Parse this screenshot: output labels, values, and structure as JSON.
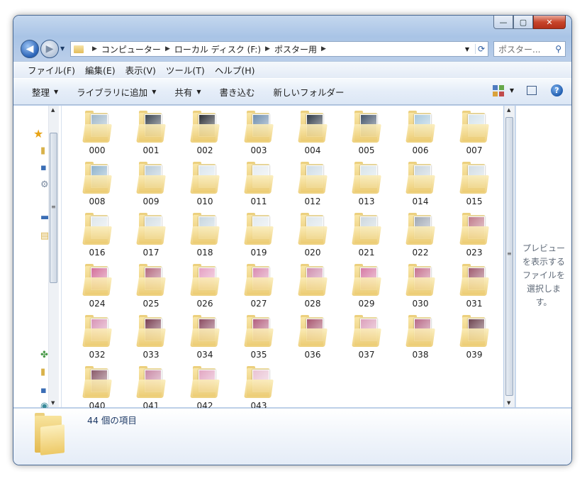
{
  "window": {
    "caption_buttons": [
      "minimize",
      "maximize",
      "close"
    ]
  },
  "address_bar": {
    "breadcrumbs": [
      "コンピューター",
      "ローカル ディスク (F:)",
      "ポスター用"
    ]
  },
  "search": {
    "placeholder": "ポスター..."
  },
  "menu": {
    "items": [
      "ファイル(F)",
      "編集(E)",
      "表示(V)",
      "ツール(T)",
      "ヘルプ(H)"
    ]
  },
  "command_bar": {
    "organize": "整理",
    "add_to_library": "ライブラリに追加",
    "share": "共有",
    "burn": "書き込む",
    "new_folder": "新しいフォルダー"
  },
  "folders": [
    {
      "name": "000",
      "tint": "#9fb7c9"
    },
    {
      "name": "001",
      "tint": "#3c4652"
    },
    {
      "name": "002",
      "tint": "#2b2f36"
    },
    {
      "name": "003",
      "tint": "#6e8eae"
    },
    {
      "name": "004",
      "tint": "#2f3a48"
    },
    {
      "name": "005",
      "tint": "#44556b"
    },
    {
      "name": "006",
      "tint": "#a9c9de"
    },
    {
      "name": "007",
      "tint": "#d4e3ec"
    },
    {
      "name": "008",
      "tint": "#8fb3cc"
    },
    {
      "name": "009",
      "tint": "#b8cbd8"
    },
    {
      "name": "010",
      "tint": "#dbe6ee"
    },
    {
      "name": "011",
      "tint": "#e6ecf0"
    },
    {
      "name": "012",
      "tint": "#cfdde6"
    },
    {
      "name": "013",
      "tint": "#d8e4ea"
    },
    {
      "name": "014",
      "tint": "#c9d5dd"
    },
    {
      "name": "015",
      "tint": "#d2dde4"
    },
    {
      "name": "016",
      "tint": "#dfe7ec"
    },
    {
      "name": "017",
      "tint": "#d3dee4"
    },
    {
      "name": "018",
      "tint": "#c7d6df"
    },
    {
      "name": "019",
      "tint": "#e3eaee"
    },
    {
      "name": "020",
      "tint": "#dde6eb"
    },
    {
      "name": "021",
      "tint": "#cdd8df"
    },
    {
      "name": "022",
      "tint": "#a0a8b4"
    },
    {
      "name": "023",
      "tint": "#c07b8a"
    },
    {
      "name": "024",
      "tint": "#d36f9a"
    },
    {
      "name": "025",
      "tint": "#b46a80"
    },
    {
      "name": "026",
      "tint": "#e5a0c2"
    },
    {
      "name": "027",
      "tint": "#d98bb0"
    },
    {
      "name": "028",
      "tint": "#cf8fae"
    },
    {
      "name": "029",
      "tint": "#d67aa4"
    },
    {
      "name": "030",
      "tint": "#c6728f"
    },
    {
      "name": "031",
      "tint": "#9f5a6e"
    },
    {
      "name": "032",
      "tint": "#d894b6"
    },
    {
      "name": "033",
      "tint": "#7a3f52"
    },
    {
      "name": "034",
      "tint": "#8c4c62"
    },
    {
      "name": "035",
      "tint": "#b45f7e"
    },
    {
      "name": "036",
      "tint": "#a8566f"
    },
    {
      "name": "037",
      "tint": "#dca0bb"
    },
    {
      "name": "038",
      "tint": "#b86a88"
    },
    {
      "name": "039",
      "tint": "#6e4450"
    },
    {
      "name": "040",
      "tint": "#8a5a6a"
    },
    {
      "name": "041",
      "tint": "#c98aa6"
    },
    {
      "name": "042",
      "tint": "#e2a6c2"
    },
    {
      "name": "043",
      "tint": "#e9c2d3"
    }
  ],
  "preview_pane": {
    "message": "プレビューを表示するファイルを選択します。"
  },
  "details_pane": {
    "item_count": "44 個の項目"
  }
}
